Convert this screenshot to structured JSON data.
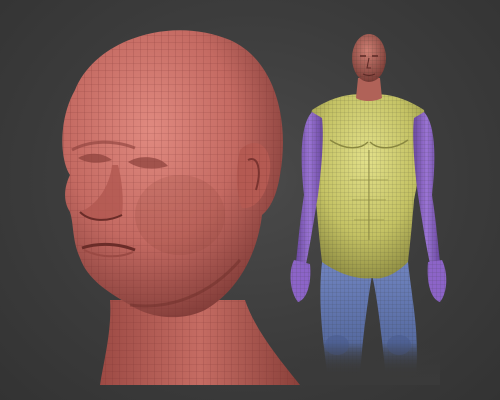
{
  "scene": {
    "background_color": "#3c3c3c",
    "models": [
      {
        "name": "head-bust",
        "polygroups": [
          {
            "name": "head",
            "color": "#c86464"
          }
        ],
        "wireframe_color": "#6e2a2a"
      },
      {
        "name": "full-body",
        "polygroups": [
          {
            "name": "head-neck",
            "color": "#c06a5e"
          },
          {
            "name": "torso",
            "color": "#c8c864"
          },
          {
            "name": "arms",
            "color": "#8c64c8"
          },
          {
            "name": "legs",
            "color": "#6478b4"
          }
        ],
        "wireframe_color": "#3a3a30"
      }
    ]
  }
}
